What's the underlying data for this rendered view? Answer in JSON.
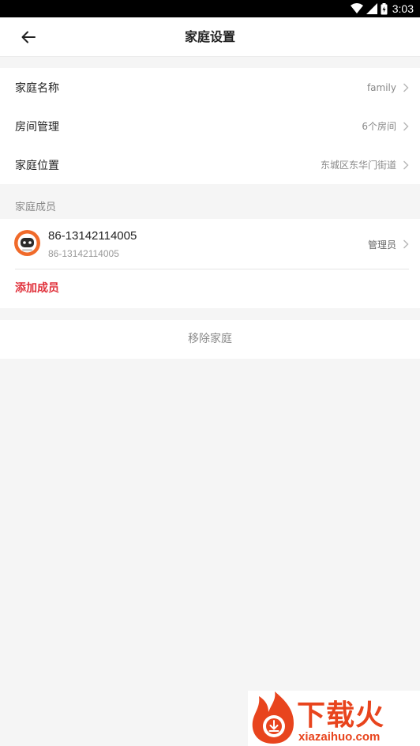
{
  "status_bar": {
    "time": "3:03"
  },
  "header": {
    "title": "家庭设置"
  },
  "settings": {
    "rows": [
      {
        "label": "家庭名称",
        "value": "family"
      },
      {
        "label": "房间管理",
        "value": "6个房间"
      },
      {
        "label": "家庭位置",
        "value": "东城区东华门街道"
      }
    ]
  },
  "members_section": {
    "title": "家庭成员",
    "members": [
      {
        "name": "86-13142114005",
        "subtitle": "86-13142114005",
        "role": "管理员"
      }
    ],
    "add_label": "添加成员"
  },
  "remove_label": "移除家庭",
  "watermark": {
    "text": "下载火",
    "url": "xiazaihuo.com"
  },
  "colors": {
    "accent_red": "#e0303a",
    "avatar_orange": "#f06a2a",
    "watermark": "#e8441d"
  }
}
